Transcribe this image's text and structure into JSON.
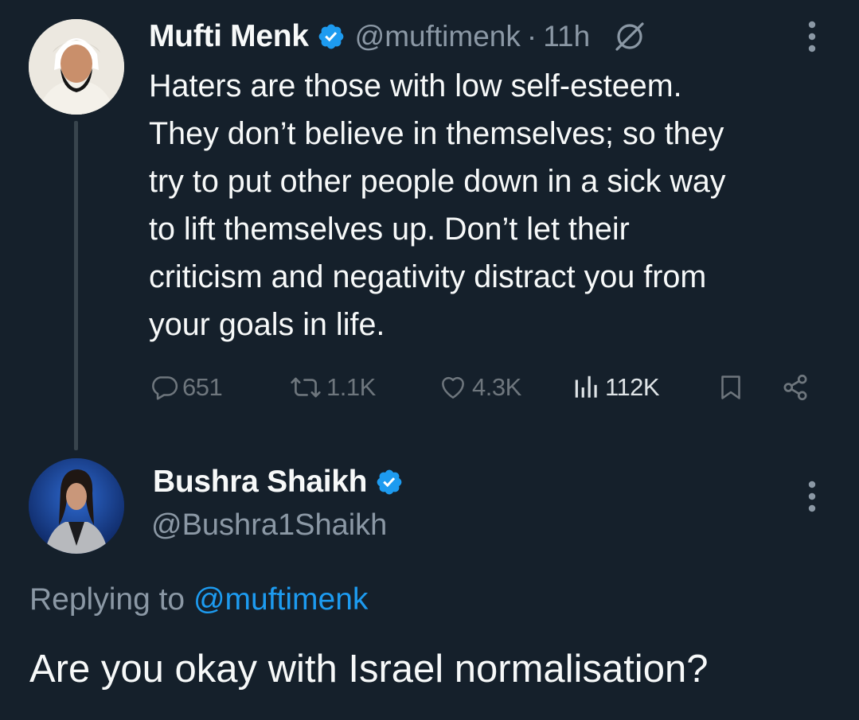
{
  "colors": {
    "background": "#15202b",
    "text_primary": "#f7f9f9",
    "text_secondary": "#8b98a5",
    "icon_muted": "#6e767d",
    "accent_blue": "#1d9bf0",
    "thread_line": "#38444d"
  },
  "tweet": {
    "author_name": "Mufti Menk",
    "handle": "@muftimenk",
    "separator": "·",
    "time": "11h",
    "verified_icon": "verified-badge-icon",
    "grok_icon": "grok-icon",
    "more_icon": "more-vertical-icon",
    "avatar": "avatar-mufti-menk",
    "text": "Haters are those with low self-esteem.\nThey don’t believe in themselves; so they\ntry to put other people down in a sick way\nto lift themselves up. Don’t let their\ncriticism and negativity distract you from\nyour goals in life.",
    "actions": {
      "replies": "651",
      "retweets": "1.1K",
      "likes": "4.3K",
      "views": "112K"
    }
  },
  "reply": {
    "author_name": "Bushra Shaikh",
    "handle": "@Bushra1Shaikh",
    "verified_icon": "verified-badge-icon",
    "more_icon": "more-vertical-icon",
    "avatar": "avatar-bushra-shaikh",
    "replying_prefix": "Replying to ",
    "replying_mention": "@muftimenk",
    "text": "Are you okay with Israel normalisation?"
  }
}
